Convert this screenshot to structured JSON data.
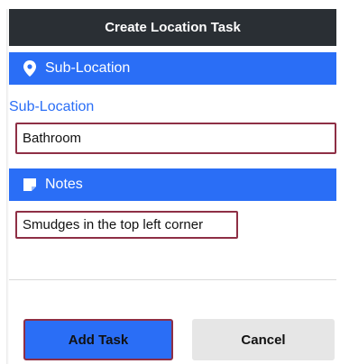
{
  "header": {
    "title": "Create Location Task"
  },
  "sections": {
    "sublocation_header": "Sub-Location",
    "notes_header": "Notes"
  },
  "form": {
    "sublocation_label": "Sub-Location",
    "sublocation_value": "Bathroom",
    "notes_value": "Smudges in the top left corner"
  },
  "actions": {
    "add_label": "Add Task",
    "cancel_label": "Cancel"
  },
  "colors": {
    "title_bar": "#2a2f34",
    "accent": "#2a6ef6",
    "highlight_border": "#8e2f45",
    "cancel_bg": "#e6e6e6"
  },
  "icons": {
    "sublocation": "map-pin-icon",
    "notes": "note-icon"
  }
}
